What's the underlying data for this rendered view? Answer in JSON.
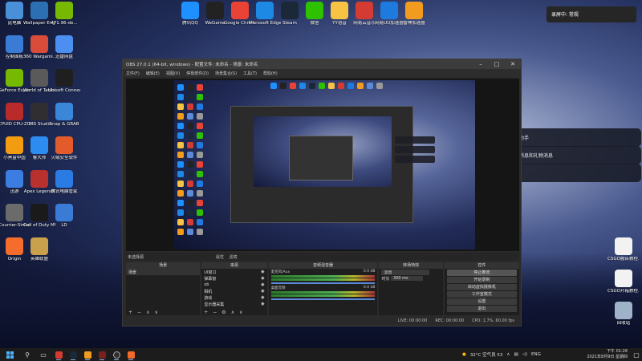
{
  "desktop_left": [
    {
      "label": "此电脑",
      "color": "#4a90d9"
    },
    {
      "label": "Wallpaper Engine: ...",
      "color": "#2d6fb3"
    },
    {
      "label": "471.96-de...",
      "color": "#76b900"
    },
    {
      "label": "控制面板",
      "color": "#3a7bd5"
    },
    {
      "label": "360 Wargami...",
      "color": "#d94c3a"
    },
    {
      "label": "迅雷网盘",
      "color": "#4d8ff0"
    },
    {
      "label": "GeForce Experience",
      "color": "#76b900"
    },
    {
      "label": "World of Tanks",
      "color": "#5a5a5a"
    },
    {
      "label": "Ubisoft Connect",
      "color": "#1f1f1f"
    },
    {
      "label": "CPUID CPU-Z MSI",
      "color": "#b92a2a"
    },
    {
      "label": "OBS Studio",
      "color": "#302e31"
    },
    {
      "label": "Snap & GRAB",
      "color": "#3a86d9"
    },
    {
      "label": "小黑盒中国",
      "color": "#f39c12"
    },
    {
      "label": "鲁大师",
      "color": "#2c8cf0"
    },
    {
      "label": "火绒安全软件",
      "color": "#e45b2b"
    },
    {
      "label": "迅游",
      "color": "#3b7de0"
    },
    {
      "label": "Apex Legends",
      "color": "#b8312f"
    },
    {
      "label": "腾讯电脑管家",
      "color": "#2a7be4"
    },
    {
      "label": "Counter-Strike",
      "color": "#6b6b6b"
    },
    {
      "label": "Call of Duty MW",
      "color": "#1a1a1a"
    },
    {
      "label": "LD",
      "color": "#3a7bd5"
    },
    {
      "label": "Origin",
      "color": "#f56c2d"
    },
    {
      "label": "英雄联盟",
      "color": "#c9a04b"
    }
  ],
  "desktop_top": [
    {
      "label": "腾讯QQ",
      "color": "#1e90ff"
    },
    {
      "label": "WeGame",
      "color": "#222222"
    },
    {
      "label": "Google Chrome",
      "color": "#ea4335"
    },
    {
      "label": "Microsoft Edge",
      "color": "#1e88e5"
    },
    {
      "label": "Steam",
      "color": "#1b2838"
    },
    {
      "label": "微信",
      "color": "#2dc100"
    },
    {
      "label": "YY语音",
      "color": "#f6c343"
    },
    {
      "label": "网易云音乐",
      "color": "#d43c33"
    },
    {
      "label": "网易UU加速器",
      "color": "#1f7ae0"
    },
    {
      "label": "雷神加速器",
      "color": "#f29c1f"
    }
  ],
  "desktop_right": [
    {
      "label": "CSGO搬砖教程.txt",
      "color": "#f2f2f2"
    },
    {
      "label": "CSGO开箱教程.txt",
      "color": "#f2f2f2"
    },
    {
      "label": "回收站",
      "color": "#9fb3c8"
    }
  ],
  "notification_top": "录屏中: 常规",
  "toasts": [
    "欢迎使用斗鱼弹幕助手",
    "本区域会显示弹幕消息和礼物消息",
    "添加弹幕助手成功"
  ],
  "obs": {
    "title": "OBS 27.0.1 (64-bit, windows) - 配置文件: 未命名 - 场景: 未命名",
    "menu": [
      "文件(F)",
      "编辑(E)",
      "视图(V)",
      "停靠部件(D)",
      "场景集合(S)",
      "工具(T)",
      "帮助(H)"
    ],
    "no_source": "未选择源",
    "props_label": "属性",
    "filters_label": "滤镜",
    "docks": {
      "scenes": {
        "title": "场景",
        "items": [
          "场景"
        ]
      },
      "sources": {
        "title": "来源",
        "items": [
          "UI窗口",
          "弹幕窗",
          "xb",
          "相机",
          "游戏",
          "显示器采集"
        ]
      },
      "mixer": {
        "title": "音频混音器",
        "rows": [
          {
            "name": "麦克风/Aux",
            "db": "0.0 dB"
          },
          {
            "name": "桌面音频",
            "db": "0.0 dB"
          }
        ]
      },
      "transitions": {
        "title": "转场特效",
        "type": "淡出",
        "duration_label": "时长",
        "duration": "300 ms"
      },
      "controls": {
        "title": "控件",
        "buttons": [
          "停止推流",
          "开始录制",
          "启动虚拟摄像机",
          "工作室模式",
          "设置",
          "退出"
        ]
      }
    },
    "status": [
      "LIVE: 00:00:00",
      "REC: 00:00:00",
      "CPU: 1.7%, 60.00 fps"
    ]
  },
  "taskbar": {
    "weather": "32°C 空气良 53",
    "lang": "ENG",
    "time": "下午 01:26",
    "date": "2021年8月9日 星期四"
  }
}
